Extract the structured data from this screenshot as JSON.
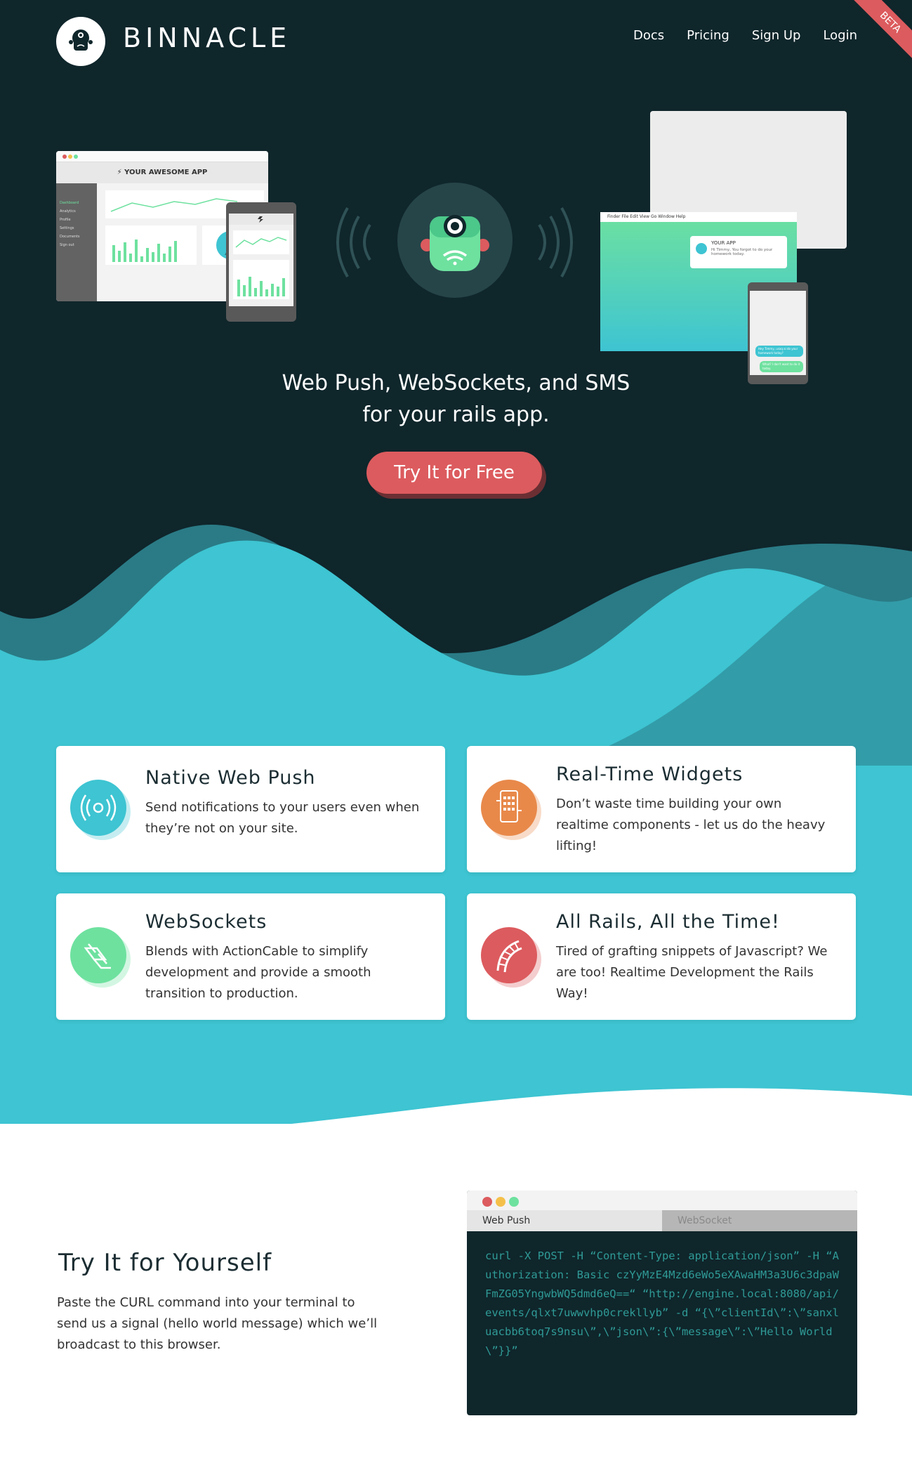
{
  "header": {
    "brand": "BINNACLE",
    "nav": [
      "Docs",
      "Pricing",
      "Sign Up",
      "Login"
    ],
    "badge": "BETA"
  },
  "hero": {
    "laptop_title": "⚡ YOUR AWESOME APP",
    "laptop_menu": [
      "Dashboard",
      "Analytics",
      "Profile",
      "Settings",
      "Documents",
      "Sign out"
    ],
    "mac_menu": "Finder  File  Edit  View  Go  Window  Help",
    "notification_title": "YOUR APP",
    "notification_body": "Hi Timmy, You forgot to do your homework today.",
    "chat_1": "Hey Timmy, usaq ai do your homework today?",
    "chat_2": "What? I don't want to do it today.",
    "tagline_1": "Web Push, WebSockets, and SMS",
    "tagline_2": "for your rails app.",
    "cta": "Try It for Free"
  },
  "features": [
    {
      "title": "Native Web Push",
      "body": "Send notifications to your users even when they’re not on your site.",
      "color": "#3ec4d2",
      "icon": "broadcast-icon"
    },
    {
      "title": "Real-Time Widgets",
      "body": "Don’t waste time building your own realtime components - let us do the heavy lifting!",
      "color": "#e8894a",
      "icon": "phone-widget-icon"
    },
    {
      "title": "WebSockets",
      "body": "Blends with ActionCable to simplify development and provide a smooth transition to production.",
      "color": "#6ee19f",
      "icon": "socket-icon"
    },
    {
      "title": "All Rails, All the Time!",
      "body": "Tired of grafting snippets of Javascript? We are too! Realtime Development the Rails Way!",
      "color": "#dc5b5e",
      "icon": "rails-icon"
    }
  ],
  "try": {
    "title": "Try It for Yourself",
    "body": "Paste the CURL command into your terminal to send us a signal (hello world message) which we’ll broadcast to this browser.",
    "tabs": [
      "Web Push",
      "WebSocket"
    ],
    "code": "curl -X POST -H “Content-Type: application/json” -H “Authorization: Basic czYyMzE4Mzd6eWo5eXAwaHM3a3U6c3dpaWFmZG05YngwbWQ5dmd6eQ==“ “http://engine.local:8080/api/events/qlxt7uwwvhp0crekllyb” -d “{\\”clientId\\”:\\”sanxluacbb6toq7s9nsu\\”,\\”json\\”:{\\”message\\”:\\”Hello World\\”}}”"
  },
  "colors": {
    "dark": "#0f262b",
    "teal": "#3ec4d2",
    "red": "#dc5b5e",
    "green": "#6ee19f",
    "orange": "#e8894a"
  }
}
